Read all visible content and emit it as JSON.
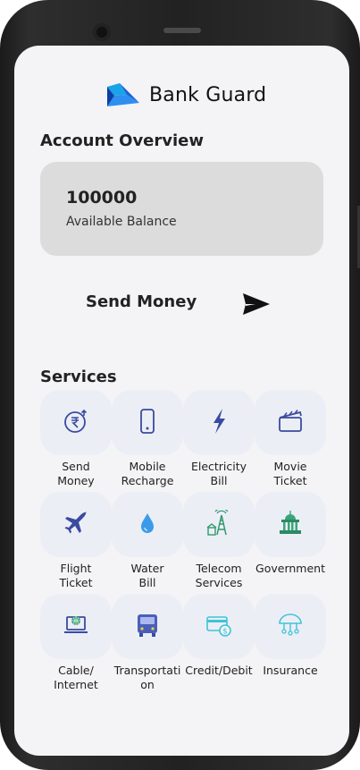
{
  "app": {
    "brand_name": "Bank Guard"
  },
  "overview": {
    "title": "Account Overview",
    "balance_amount": "100000",
    "balance_label": "Available Balance"
  },
  "send_money": {
    "label": "Send Money",
    "icon": "send-icon"
  },
  "services": {
    "title": "Services",
    "items": [
      {
        "label": "Send\nMoney",
        "icon": "rupee-transfer-icon"
      },
      {
        "label": "Mobile\nRecharge",
        "icon": "smartphone-icon"
      },
      {
        "label": "Electricity\nBill",
        "icon": "lightning-icon"
      },
      {
        "label": "Movie\nTicket",
        "icon": "clapperboard-icon"
      },
      {
        "label": "Flight\nTicket",
        "icon": "airplane-icon"
      },
      {
        "label": "Water\nBill",
        "icon": "water-drop-icon"
      },
      {
        "label": "Telecom\nServices",
        "icon": "telecom-tower-icon"
      },
      {
        "label": "Government",
        "icon": "government-building-icon"
      },
      {
        "label": "Cable/\nInternet",
        "icon": "laptop-globe-icon"
      },
      {
        "label": "Transportati\non",
        "icon": "bus-icon"
      },
      {
        "label": "Credit/Debit",
        "icon": "credit-card-icon"
      },
      {
        "label": "Insurance",
        "icon": "umbrella-icon"
      }
    ]
  },
  "colors": {
    "screen_bg": "#f4f4f6",
    "card_bg": "#dcdcdc",
    "tile_bg": "#eceef6",
    "brand_blue": "#2b7de9"
  }
}
